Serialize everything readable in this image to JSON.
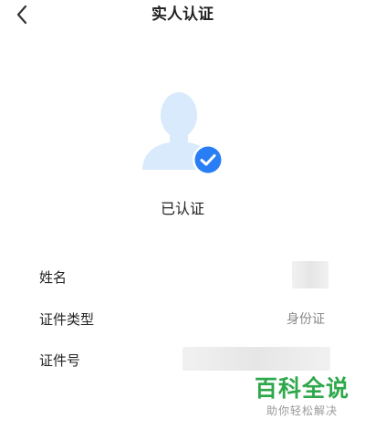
{
  "header": {
    "title": "实人认证"
  },
  "status": {
    "label": "已认证"
  },
  "info": {
    "name_label": "姓名",
    "id_type_label": "证件类型",
    "id_type_value": "身份证",
    "id_number_label": "证件号"
  },
  "watermark": {
    "main": "百科全说",
    "sub": "助你轻松解决"
  },
  "colors": {
    "accent": "#2a7ef5",
    "avatar": "#d9eafc",
    "watermark_green": "#2ea84a"
  }
}
